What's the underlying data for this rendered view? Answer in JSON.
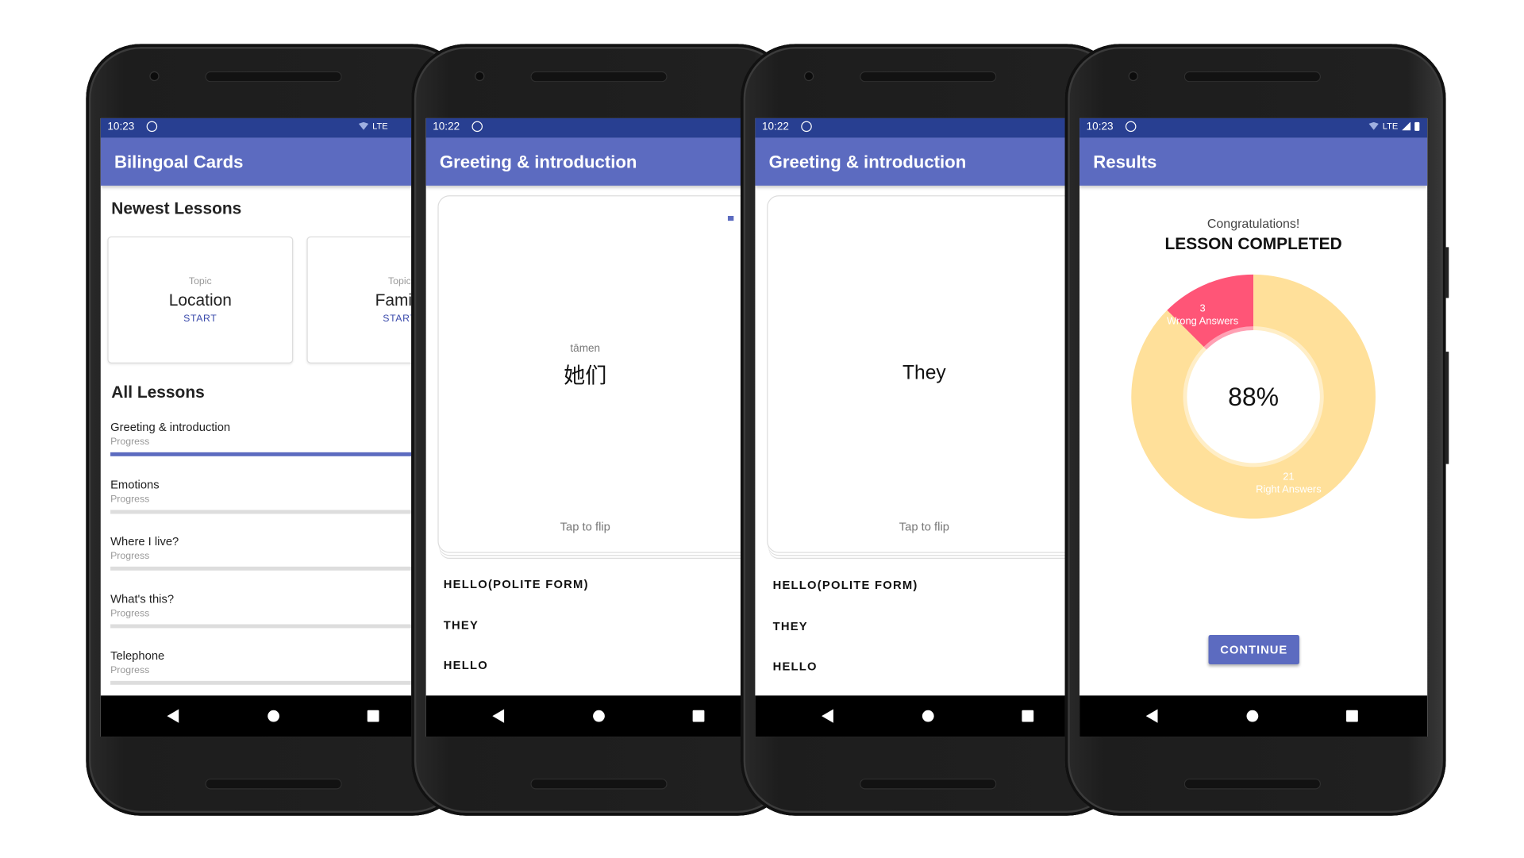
{
  "phones": {
    "home": {
      "time": "10:23",
      "title": "Bilingoal Cards",
      "newest_heading": "Newest Lessons",
      "newest": [
        {
          "label": "Topic",
          "name": "Location",
          "action": "START"
        },
        {
          "label": "Topic",
          "name": "Family",
          "action": "START"
        }
      ],
      "all_heading": "All Lessons",
      "lessons": [
        {
          "title": "Greeting & introduction",
          "sub": "Progress",
          "progress": 0.95
        },
        {
          "title": "Emotions",
          "sub": "Progress",
          "progress": 0
        },
        {
          "title": "Where I live?",
          "sub": "Progress",
          "progress": 0
        },
        {
          "title": "What's this?",
          "sub": "Progress",
          "progress": 0
        },
        {
          "title": "Telephone",
          "sub": "Progress",
          "progress": 0
        }
      ],
      "network": "LTE"
    },
    "card_front": {
      "time": "10:22",
      "title": "Greeting & introduction",
      "pinyin": "tāmen",
      "word": "她们",
      "hint": "Tap to flip",
      "options": [
        "HELLO(POLITE FORM)",
        "THEY",
        "HELLO"
      ]
    },
    "card_back": {
      "time": "10:22",
      "title": "Greeting & introduction",
      "word": "They",
      "hint": "Tap to flip",
      "options": [
        "HELLO(POLITE FORM)",
        "THEY",
        "HELLO"
      ]
    },
    "results": {
      "time": "10:23",
      "title": "Results",
      "network": "LTE",
      "congrats": "Congratulations!",
      "headline": "LESSON COMPLETED",
      "percent": "88%",
      "continue_label": "CONTINUE"
    }
  },
  "chart_data": {
    "type": "pie",
    "donut": true,
    "series": [
      {
        "name": "Wrong Answers",
        "value": 3,
        "label_value": "3",
        "color": "#ff5577"
      },
      {
        "name": "Right Answers",
        "value": 21,
        "label_value": "21",
        "color": "#ffe09a"
      }
    ],
    "center_label": "88%"
  },
  "colors": {
    "primary": "#5c6bc0",
    "status_bar": "#283f91",
    "accent": "#3949ab"
  }
}
